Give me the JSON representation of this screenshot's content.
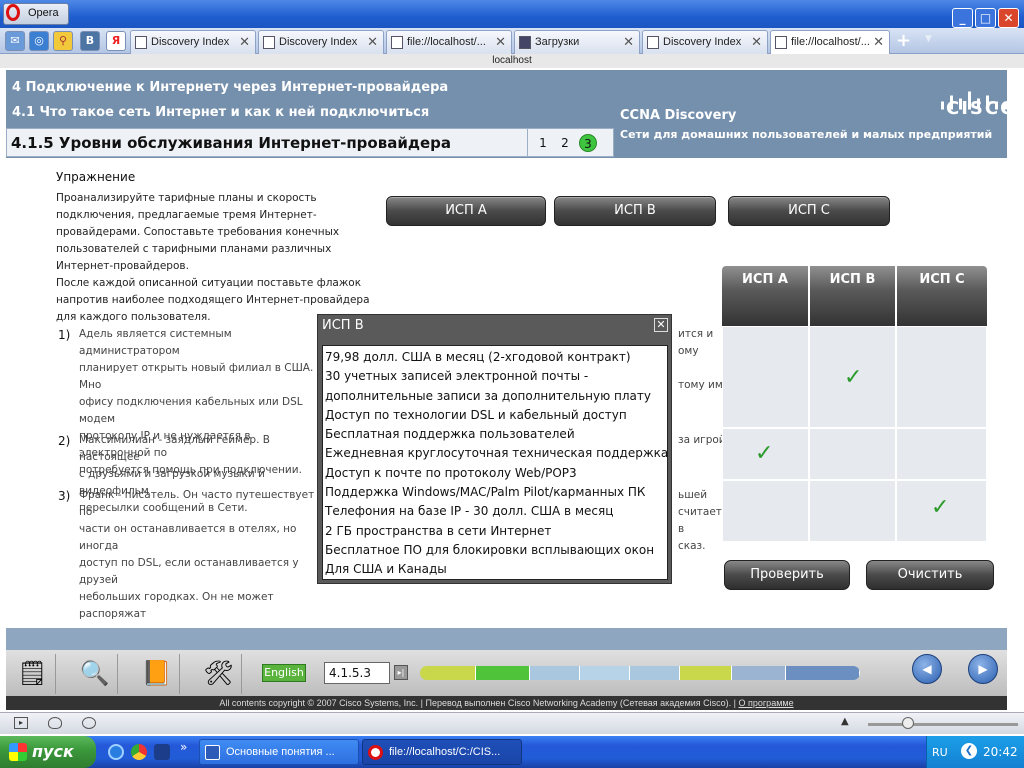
{
  "browser": {
    "menu_label": "Opera",
    "window_controls": [
      "minimize-icon",
      "maximize-icon",
      "close-icon"
    ],
    "quick_icons": [
      "mail-icon",
      "opera-icon",
      "search-icon",
      "vk-icon",
      "yandex-icon"
    ],
    "tabs": [
      {
        "label": "Discovery Index",
        "active": false
      },
      {
        "label": "Discovery Index",
        "active": false
      },
      {
        "label": "file://localhost/...",
        "active": false
      },
      {
        "label": "Загрузки",
        "active": false
      },
      {
        "label": "Discovery Index",
        "active": false
      },
      {
        "label": "file://localhost/...",
        "active": true
      }
    ],
    "add_tab": "+",
    "address": "localhost"
  },
  "header": {
    "chapter": "4 Подключение к Интернету через Интернет-провайдера",
    "section": "4.1 Что такое сеть Интернет и как к ней подключиться",
    "page_title": "4.1.5 Уровни обслуживания Интернет-провайдера",
    "pages": [
      "1",
      "2",
      "3"
    ],
    "current_page": "3",
    "course": "CCNA Discovery",
    "course_sub": "Сети для домашних пользователей и малых предприятий",
    "logo": "CISCO"
  },
  "exercise": {
    "heading": "Упражнение",
    "intro": "Проанализируйте тарифные планы и скорость подключения, предлагаемые тремя Интернет-провайдерами. Сопоставьте требования конечных пользователей с тарифными планами различных Интернет-провайдеров.",
    "instruction": "После каждой описанной ситуации поставьте флажок напротив наиболее подходящего Интернет-провайдера для каждого пользователя.",
    "isp_buttons": [
      "ИСП A",
      "ИСП B",
      "ИСП C"
    ],
    "scenarios": [
      {
        "num": "1)",
        "lines": [
          "Адель является системным администратором",
          "ится и",
          "планирует открыть новый филиал в США. Мно",
          "ому",
          "офису подключения кабельных или DSL модем",
          "протоколу IP и не нуждается в электронной по",
          "тому им",
          "потребуется помощь при подключении."
        ]
      },
      {
        "num": "2)",
        "lines": [
          "Максимилиан - заядлый геймер. В настоящее",
          "за игрой",
          "с друзьями и загрузкой музыки и видеофильм",
          "пересылки сообщений в Сети."
        ]
      },
      {
        "num": "3)",
        "lines": [
          "Франк - писатель. Он часто путешествует по",
          "ьшей",
          "части он останавливается в отелях, но иногда",
          "считает",
          "доступ по DSL, если останавливается у друзей",
          "в",
          "небольших городках. Он не может распоряжат",
          "сказ."
        ]
      }
    ],
    "grid_headers": [
      "ИСП A",
      "ИСП B",
      "ИСП C"
    ],
    "check_mark": "✓",
    "answers": [
      {
        "row": 1,
        "isp": "B"
      },
      {
        "row": 2,
        "isp": "A"
      },
      {
        "row": 3,
        "isp": "C"
      }
    ],
    "check_button": "Проверить",
    "clear_button": "Очистить"
  },
  "popup": {
    "title": "ИСП B",
    "close": "✕",
    "lines": [
      "79,98 долл. США в месяц (2-хгодовой контракт)",
      "30 учетных записей электронной почты -",
      "дополнительные записи за дополнительную плату",
      "Доступ по технологии DSL и кабельный доступ",
      "Бесплатная поддержка пользователей",
      "Ежедневная круглосуточная техническая поддержка",
      "Доступ к почте по протоколу Web/POP3",
      "Поддержка Windows/MAC/Palm Pilot/карманных ПК",
      "Телефония на базе IP - 30 долл. США в месяц",
      "2 ГБ пространства в сети Интернет",
      "Бесплатное ПО для блокировки всплывающих окон",
      "Для США и Канады"
    ]
  },
  "toolbar": {
    "tools": [
      "notes-icon",
      "search-icon",
      "book-icon",
      "tools-icon"
    ],
    "language": "English",
    "page_input": "4.1.5.3",
    "go": "▸|",
    "progress_colors": [
      "#c8d84a",
      "#4fc43a",
      "#a9c8e0",
      "#b6d3e8",
      "#a9c8e0",
      "#c8d84a",
      "#9ab4d2",
      "#6a8fc0"
    ],
    "back": "◀",
    "forward": "▶"
  },
  "footer": {
    "text": "All contents copyright © 2007 Cisco Systems, Inc. | Перевод выполнен Cisco Networking Academy (Сетевая академия Cisco). |",
    "link": "О программе"
  },
  "taskbar": {
    "start": "пуск",
    "quicklaunch": [
      "ie-icon",
      "chrome-icon",
      "media-icon"
    ],
    "more": "»",
    "tasks": [
      {
        "label": "Основные понятия ...",
        "icon": "word-icon"
      },
      {
        "label": "file://localhost/C:/CIS...",
        "icon": "opera-icon"
      }
    ],
    "lang": "RU",
    "time": "20:42"
  }
}
